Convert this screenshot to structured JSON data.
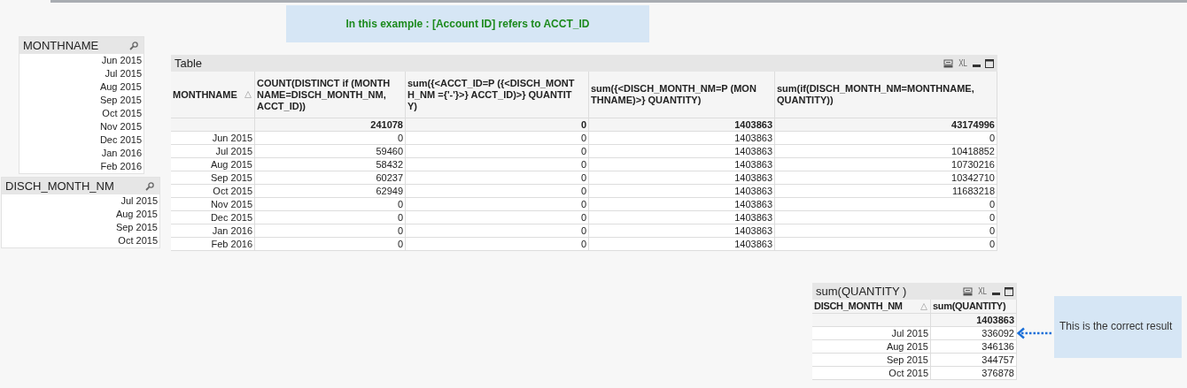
{
  "note_top": {
    "text": "In this example : [Account ID] refers to ACCT_ID"
  },
  "listboxes": [
    {
      "title": "MONTHNAME",
      "items": [
        "Jun 2015",
        "Jul 2015",
        "Aug 2015",
        "Sep 2015",
        "Oct 2015",
        "Nov 2015",
        "Dec 2015",
        "Jan 2016",
        "Feb 2016"
      ]
    },
    {
      "title": "DISCH_MONTH_NM",
      "items": [
        "Jul 2015",
        "Aug 2015",
        "Sep 2015",
        "Oct 2015"
      ]
    }
  ],
  "tables": [
    {
      "caption": "Table",
      "xl_label": "XL",
      "columns": [
        {
          "label": "MONTHNAME",
          "sorted": true
        },
        {
          "label": "COUNT(DISTINCT if (MONTHNAME=DISCH_MONTH_NM, ACCT_ID))",
          "sorted": false
        },
        {
          "label": "sum({<ACCT_ID=P ({<DISCH_MONTH_NM ={'-'}>} ACCT_ID)>} QUANTITY)",
          "sorted": false
        },
        {
          "label": "sum({<DISCH_MONTH_NM=P (MONTHNAME)>} QUANTITY)",
          "sorted": false
        },
        {
          "label": "sum(if(DISCH_MONTH_NM=MONTHNAME, QUANTITY))",
          "sorted": false
        }
      ],
      "totals": [
        "241078",
        "0",
        "1403863",
        "43174996"
      ],
      "rows": [
        [
          "Jun 2015",
          "0",
          "0",
          "1403863",
          "0"
        ],
        [
          "Jul 2015",
          "59460",
          "0",
          "1403863",
          "10418852"
        ],
        [
          "Aug 2015",
          "58432",
          "0",
          "1403863",
          "10730216"
        ],
        [
          "Sep 2015",
          "60237",
          "0",
          "1403863",
          "10342710"
        ],
        [
          "Oct 2015",
          "62949",
          "0",
          "1403863",
          "11683218"
        ],
        [
          "Nov 2015",
          "0",
          "0",
          "1403863",
          "0"
        ],
        [
          "Dec 2015",
          "0",
          "0",
          "1403863",
          "0"
        ],
        [
          "Jan 2016",
          "0",
          "0",
          "1403863",
          "0"
        ],
        [
          "Feb 2016",
          "0",
          "0",
          "1403863",
          "0"
        ]
      ]
    },
    {
      "caption": "sum(QUANTITY )",
      "xl_label": "XL",
      "columns": [
        {
          "label": "DISCH_MONTH_NM",
          "sorted": true
        },
        {
          "label": "sum(QUANTITY)",
          "sorted": false
        }
      ],
      "totals": [
        "1403863"
      ],
      "rows": [
        [
          "Jul 2015",
          "336092"
        ],
        [
          "Aug 2015",
          "346136"
        ],
        [
          "Sep 2015",
          "344757"
        ],
        [
          "Oct 2015",
          "376878"
        ]
      ]
    }
  ],
  "note_side": {
    "text": "This is the correct result"
  }
}
